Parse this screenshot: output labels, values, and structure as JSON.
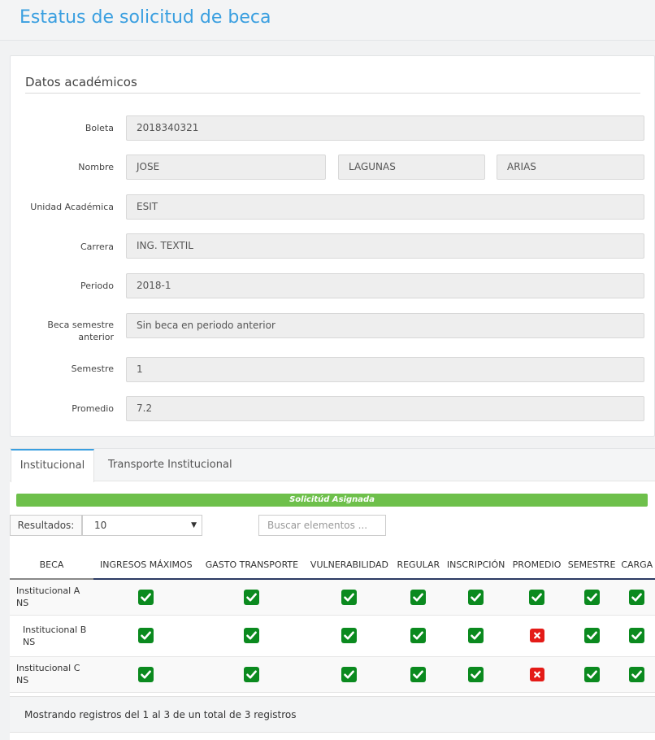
{
  "page": {
    "title": "Estatus de solicitud de beca"
  },
  "academic": {
    "title": "Datos académicos",
    "labels": {
      "boleta": "Boleta",
      "nombre": "Nombre",
      "unidad": "Unidad Académica",
      "carrera": "Carrera",
      "periodo": "Periodo",
      "beca_anterior": "Beca semestre anterior",
      "semestre": "Semestre",
      "promedio": "Promedio"
    },
    "values": {
      "boleta": "2018340321",
      "nombre": "JOSE",
      "apellido_paterno": "LAGUNAS",
      "apellido_materno": "ARIAS",
      "unidad": "ESIT",
      "carrera": "ING. TEXTIL",
      "periodo": "2018-1",
      "beca_anterior": "Sin beca en periodo anterior",
      "semestre": "1",
      "promedio": "7.2"
    }
  },
  "tabs": [
    {
      "label": "Institucional",
      "active": true
    },
    {
      "label": "Transporte Institucional",
      "active": false
    }
  ],
  "status": {
    "label": "Solicitúd Asignada",
    "color": "#6ec04b"
  },
  "controls": {
    "results_label": "Resultados:",
    "results_value": "10",
    "search_placeholder": "Buscar elementos ..."
  },
  "table": {
    "columns": [
      "BECA",
      "INGRESOS MÁXIMOS",
      "GASTO TRANSPORTE",
      "VULNERABILIDAD",
      "REGULAR",
      "INSCRIPCIÓN",
      "PROMEDIO",
      "SEMESTRE",
      "CARGA"
    ],
    "rows": [
      {
        "name": "Institucional A NS",
        "checks": [
          true,
          true,
          true,
          true,
          true,
          true,
          true,
          true
        ]
      },
      {
        "name": "Institucional B NS",
        "checks": [
          true,
          true,
          true,
          true,
          true,
          false,
          true,
          true
        ]
      },
      {
        "name": "Institucional C NS",
        "checks": [
          true,
          true,
          true,
          true,
          true,
          false,
          true,
          true
        ]
      }
    ]
  },
  "footer": {
    "info": "Mostrando registros del 1 al 3 de un total de 3 registros"
  },
  "colors": {
    "accent": "#3a9fe0",
    "ok": "#0b8a1f",
    "bad": "#e41b17"
  }
}
